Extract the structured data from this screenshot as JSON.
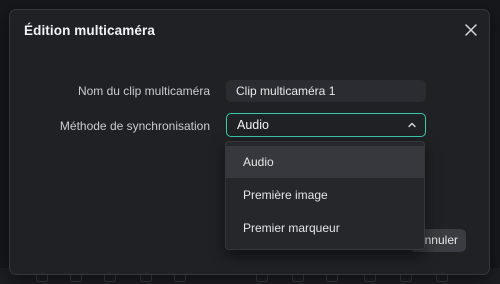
{
  "dialog": {
    "title": "Édition multicaméra",
    "close_icon": "close-icon"
  },
  "form": {
    "clip_name_label": "Nom du clip multicaméra",
    "clip_name_value": "Clip multicaméra 1",
    "sync_method_label": "Méthode de synchronisation",
    "sync_method_value": "Audio"
  },
  "dropdown": {
    "options": [
      "Audio",
      "Première image",
      "Premier marqueur"
    ],
    "selected_index": 0
  },
  "buttons": {
    "cancel_label": "Annuler"
  },
  "colors": {
    "accent": "#3cc9a8",
    "dialog_bg": "#1f2125",
    "field_bg": "#2a2c31",
    "option_selected_bg": "#36383d"
  }
}
